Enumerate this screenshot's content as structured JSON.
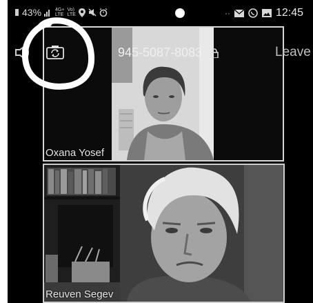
{
  "status_bar": {
    "battery": "43%",
    "signal_top": "4G+",
    "signal_bottom": "LTE",
    "volte_top": "Vo)",
    "volte_bottom": "LTE",
    "time": "12:45",
    "ellipsis": "··"
  },
  "meeting": {
    "id": "945-5087-8083",
    "leave_label": "Leave"
  },
  "participants": [
    {
      "name": "Oxana Yosef"
    },
    {
      "name": "Reuven Segev"
    }
  ],
  "icons": {
    "battery": "battery-icon",
    "signal": "signal-bars-icon",
    "location": "location-icon",
    "mute": "no-sound-icon",
    "alarm": "alarm-icon",
    "mail": "mail-icon",
    "whatsapp": "whatsapp-icon",
    "gallery": "image-icon",
    "speaker": "speaker-icon",
    "switch_camera": "switch-camera-icon",
    "lock": "lock-icon"
  }
}
